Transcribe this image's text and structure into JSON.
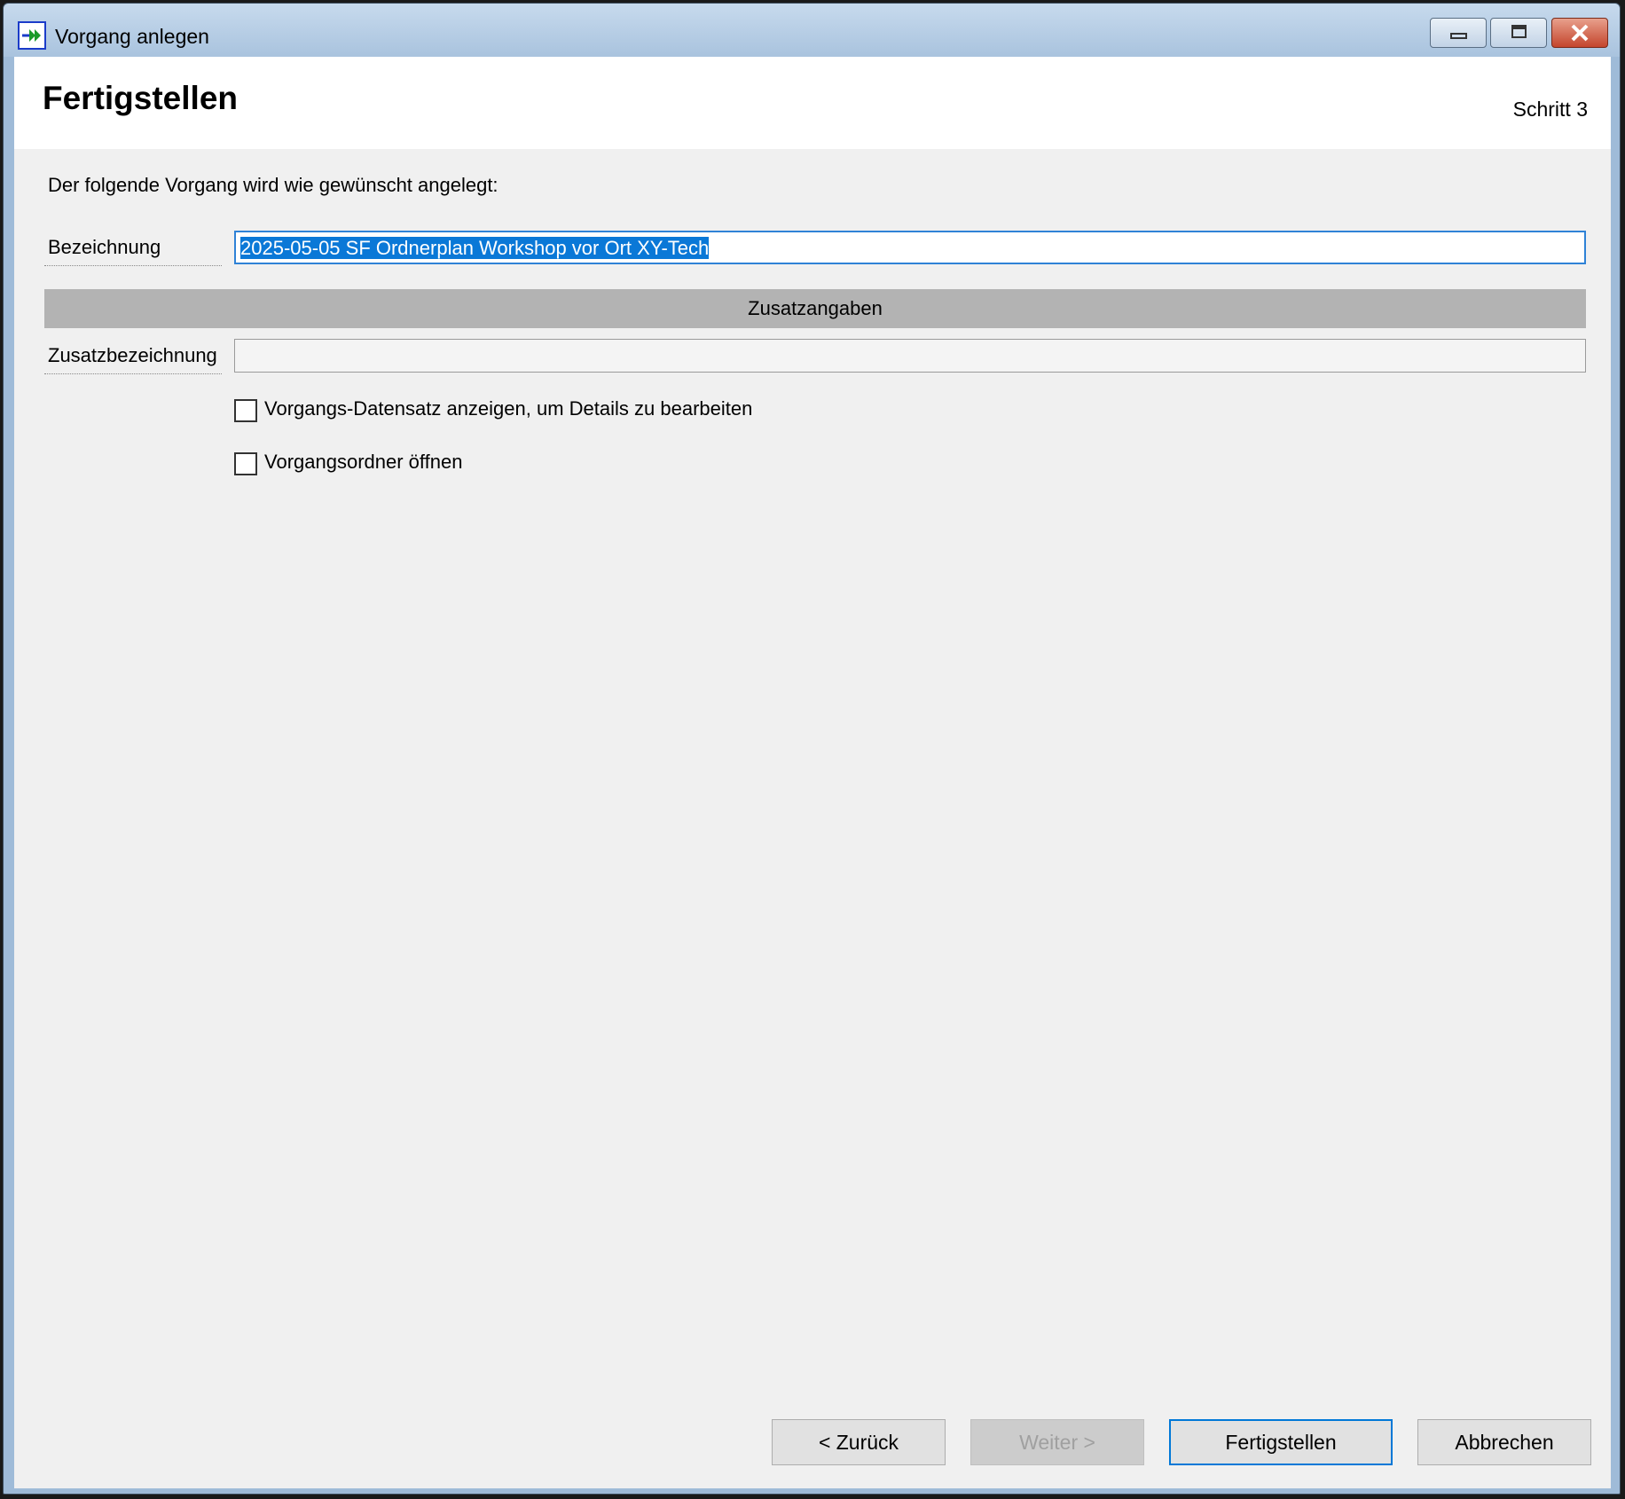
{
  "window": {
    "title": "Vorgang anlegen"
  },
  "header": {
    "title": "Fertigstellen",
    "step": "Schritt 3"
  },
  "intro": "Der folgende Vorgang wird wie gewünscht angelegt:",
  "form": {
    "bezeichnung_label": "Bezeichnung",
    "bezeichnung_value": "2025-05-05 SF Ordnerplan Workshop vor Ort XY-Tech",
    "section_title": "Zusatzangaben",
    "zusatz_label": "Zusatzbezeichnung",
    "zusatz_value": ""
  },
  "options": [
    {
      "label": "Vorgangs-Datensatz anzeigen, um Details zu bearbeiten",
      "checked": false
    },
    {
      "label": "Vorgangsordner öffnen",
      "checked": false
    }
  ],
  "buttons": {
    "back": "< Zurück",
    "next": "Weiter >",
    "finish": "Fertigstellen",
    "cancel": "Abbrechen"
  },
  "colors": {
    "selection": "#0a78d7",
    "focus_border": "#2f82d6",
    "section_bar": "#b3b3b3"
  }
}
